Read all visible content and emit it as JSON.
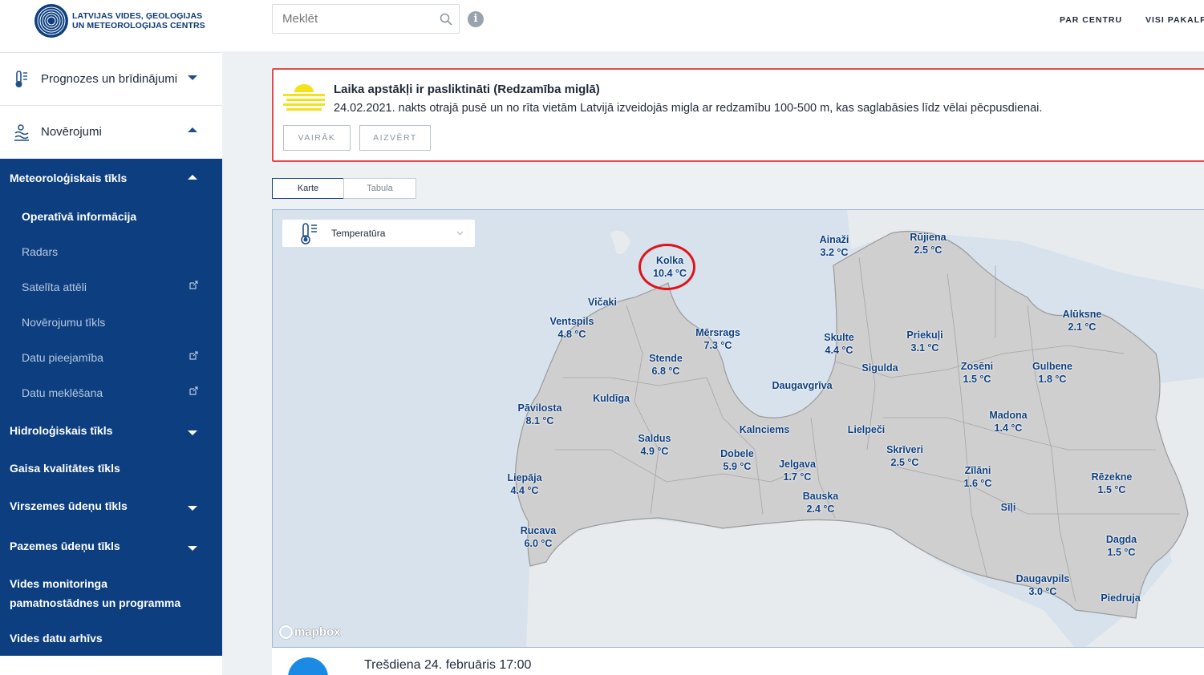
{
  "brand": {
    "line1": "LATVIJAS VIDES, ĢEOLOĢIJAS",
    "line2": "UN METEOROLOĢIJAS CENTRS"
  },
  "sidebar": {
    "top_items": [
      {
        "label": "Prognozes un brīdinājumi",
        "icon": "thermometer-icon",
        "expanded": false
      },
      {
        "label": "Novērojumi",
        "icon": "observation-icon",
        "expanded": true
      }
    ],
    "sections": [
      {
        "label": "Meteoroloģiskais tīkls",
        "expanded": true,
        "children": [
          {
            "label": "Operatīvā informācija",
            "active": true
          },
          {
            "label": "Radars"
          },
          {
            "label": "Satelīta attēli",
            "external": true
          },
          {
            "label": "Novērojumu tīkls"
          },
          {
            "label": "Datu pieejamība",
            "external": true
          },
          {
            "label": "Datu meklēšana",
            "external": true
          }
        ]
      },
      {
        "label": "Hidroloģiskais tīkls",
        "expanded": false
      },
      {
        "label": "Gaisa kvalitātes tīkls"
      },
      {
        "label": "Virszemes ūdeņu tīkls",
        "expanded": false
      },
      {
        "label": "Pazemes ūdeņu tīkls",
        "expanded": false
      },
      {
        "label_line1": "Vides monitoringa",
        "label_line2": "pamatnostādnes un programma"
      },
      {
        "label": "Vides datu arhīvs"
      }
    ]
  },
  "header": {
    "search_placeholder": "Meklēt",
    "nav": [
      "PAR CENTRU",
      "VISI PAKALPOJUMI"
    ]
  },
  "alert": {
    "title": "Laika apstākļi ir pasliktināti (Redzamība miglā)",
    "text": "24.02.2021. nakts otrajā pusē un no rīta vietām Latvijā izveidojās migla ar redzamību 100-500 m, kas saglabāsies līdz vēlai pēcpusdienai.",
    "more_label": "VAIRĀK",
    "close_label": "AIZVĒRT",
    "accent": "#e8474e",
    "icon_color": "#f2e11b"
  },
  "view_tabs": [
    "Karte",
    "Tabula"
  ],
  "map": {
    "layer_label": "Temperatūra",
    "attribution": "mapbox",
    "highlighted_station": "Kolka",
    "stations": [
      {
        "name": "Kolka",
        "temp": "10.4 °C"
      },
      {
        "name": "Ainaži",
        "temp": "3.2 °C"
      },
      {
        "name": "Rūjiena",
        "temp": "2.5 °C"
      },
      {
        "name": "Vičaki",
        "temp": ""
      },
      {
        "name": "Ventspils",
        "temp": "4.8 °C"
      },
      {
        "name": "Mērsrags",
        "temp": "7.3 °C"
      },
      {
        "name": "Skulte",
        "temp": "4.4 °C"
      },
      {
        "name": "Priekuļi",
        "temp": "3.1 °C"
      },
      {
        "name": "Alūksne",
        "temp": "2.1 °C"
      },
      {
        "name": "Stende",
        "temp": "6.8 °C"
      },
      {
        "name": "Sigulda",
        "temp": ""
      },
      {
        "name": "Zosēni",
        "temp": "1.5 °C"
      },
      {
        "name": "Gulbene",
        "temp": "1.8 °C"
      },
      {
        "name": "Daugavgrīva",
        "temp": ""
      },
      {
        "name": "Kuldīga",
        "temp": ""
      },
      {
        "name": "Pāvilosta",
        "temp": "8.1 °C"
      },
      {
        "name": "Madona",
        "temp": "1.4 °C"
      },
      {
        "name": "Kalnciems",
        "temp": ""
      },
      {
        "name": "Lielpeči",
        "temp": ""
      },
      {
        "name": "Saldus",
        "temp": "4.9 °C"
      },
      {
        "name": "Dobele",
        "temp": "5.9 °C"
      },
      {
        "name": "Jelgava",
        "temp": "1.7 °C"
      },
      {
        "name": "Skrīveri",
        "temp": "2.5 °C"
      },
      {
        "name": "Liepāja",
        "temp": "4.4 °C"
      },
      {
        "name": "Zīlāni",
        "temp": "1.6 °C"
      },
      {
        "name": "Rēzekne",
        "temp": "1.5 °C"
      },
      {
        "name": "Bauska",
        "temp": "2.4 °C"
      },
      {
        "name": "Sīļi",
        "temp": ""
      },
      {
        "name": "Rucava",
        "temp": "6.0 °C"
      },
      {
        "name": "Dagda",
        "temp": "1.5 °C"
      },
      {
        "name": "Daugavpils",
        "temp": "3.0 °C"
      },
      {
        "name": "Piedruja",
        "temp": ""
      }
    ]
  },
  "timeline": {
    "datetime": "Trešdiena 24. februāris 17:00"
  },
  "colors": {
    "nav_blue": "#0d3f80",
    "station_text": "#0d3f80",
    "play_button": "#1a8ae5",
    "highlight": "#e0121a"
  }
}
